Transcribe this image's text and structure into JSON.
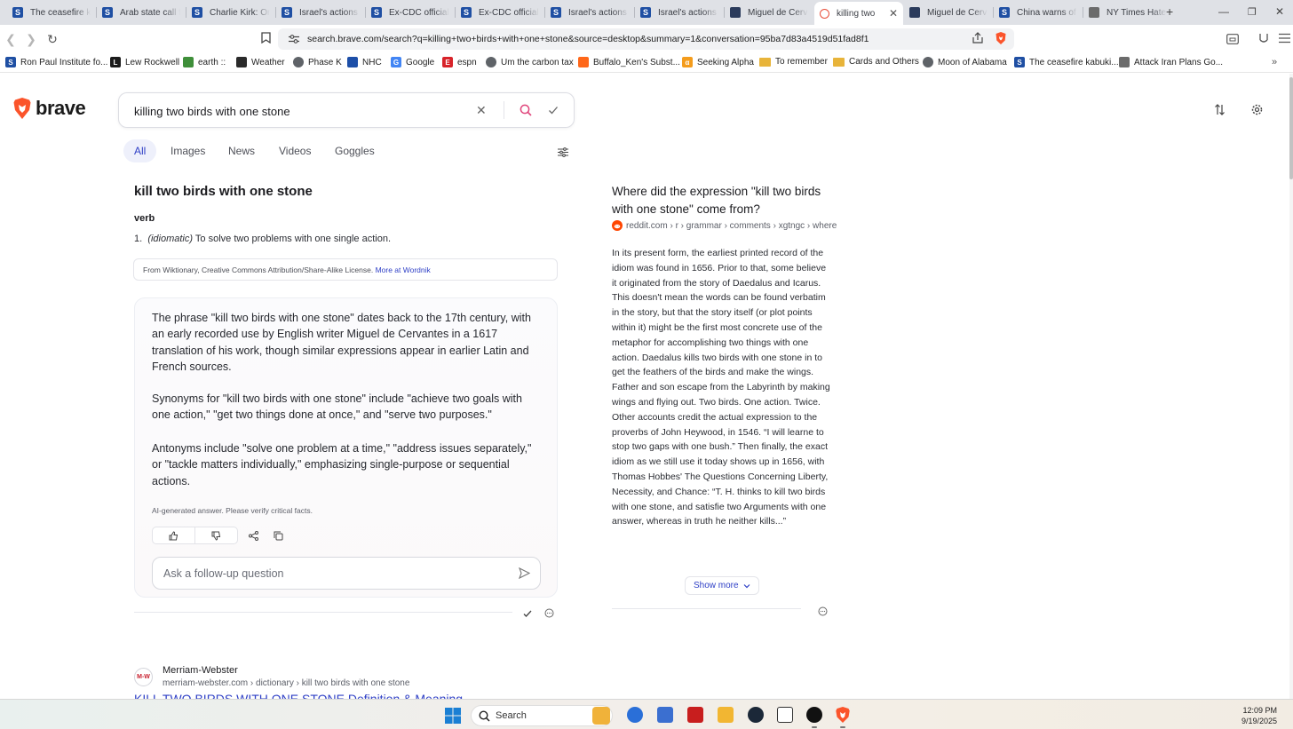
{
  "browser": {
    "tabs": [
      {
        "title": "The ceasefire k",
        "icon": "s"
      },
      {
        "title": "Arab state call f",
        "icon": "s"
      },
      {
        "title": "Charlie Kirk: Or",
        "icon": "s"
      },
      {
        "title": "Israel's actions",
        "icon": "s"
      },
      {
        "title": "Ex-CDC official",
        "icon": "s"
      },
      {
        "title": "Ex-CDC official",
        "icon": "s"
      },
      {
        "title": "Israel's actions",
        "icon": "s"
      },
      {
        "title": "Israel's actions",
        "icon": "s"
      },
      {
        "title": "Miguel de Cerv",
        "icon": "m"
      },
      {
        "title": "killing two",
        "icon": "b",
        "active": true
      },
      {
        "title": "Miguel de Cerv",
        "icon": "m"
      },
      {
        "title": "China warns of",
        "icon": "s"
      },
      {
        "title": "NY Times Hate",
        "icon": "n"
      }
    ],
    "url": "search.brave.com/search?q=killing+two+birds+with+one+stone&source=desktop&summary=1&conversation=95ba7d83a4519d51fad8f1",
    "bookmarks": [
      {
        "label": "Ron Paul Institute fo...",
        "icon": "s"
      },
      {
        "label": "Lew Rockwell",
        "icon": "lrc"
      },
      {
        "label": "earth ::",
        "icon": "earth"
      },
      {
        "label": "Weather",
        "icon": "weather"
      },
      {
        "label": "Phase K",
        "icon": "globe"
      },
      {
        "label": "NHC",
        "icon": "nhc"
      },
      {
        "label": "Google",
        "icon": "google"
      },
      {
        "label": "espn",
        "icon": "espn"
      },
      {
        "label": "Um the carbon tax",
        "icon": "globe"
      },
      {
        "label": "Buffalo_Ken's Subst...",
        "icon": "substack"
      },
      {
        "label": "Seeking Alpha",
        "icon": "alpha"
      },
      {
        "label": "To remember",
        "icon": "folder"
      },
      {
        "label": "Cards and Others",
        "icon": "folder"
      },
      {
        "label": "Moon of Alabama",
        "icon": "globe"
      },
      {
        "label": "The ceasefire kabuki...",
        "icon": "s"
      },
      {
        "label": "Attack Iran Plans Go...",
        "icon": "img"
      }
    ]
  },
  "search": {
    "logo_text": "brave",
    "query": "killing two birds with one stone",
    "tabs": [
      "All",
      "Images",
      "News",
      "Videos",
      "Goggles"
    ],
    "active_tab": "All"
  },
  "definition": {
    "title": "kill two birds with one stone",
    "part_of_speech": "verb",
    "number": "1.",
    "label": "(idiomatic)",
    "text": "To solve two problems with one single action.",
    "source_text": "From Wiktionary, Creative Commons Attribution/Share-Alike License.",
    "source_link": "More at Wordnik"
  },
  "ai_answer": {
    "paragraphs": [
      "The phrase \"kill two birds with one stone\" dates back to the 17th century, with an early recorded use by English writer Miguel de Cervantes in a 1617 translation of his work, though similar expressions appear in earlier Latin and French sources.",
      "Synonyms for \"kill two birds with one stone\" include \"achieve two goals with one action,\" \"get two things done at once,\" and \"serve two purposes.\"",
      "Antonyms include \"solve one problem at a time,\" \"address issues separately,\" or \"tackle matters individually,\" emphasizing single-purpose or sequential actions."
    ],
    "disclaimer": "AI-generated answer. Please verify critical facts.",
    "followup_placeholder": "Ask a follow-up question"
  },
  "discussion": {
    "title": "Where did the expression \"kill two birds with one stone\" come from?",
    "source": "reddit.com › r › grammar › comments › xgtngc › where",
    "body": "In its present form, the earliest printed record of the idiom was found in 1656. Prior to that, some believe it originated from the story of Daedalus and Icarus. This doesn't mean the words can be found verbatim in the story, but that the story itself (or plot points within it) might be the first most concrete use of the metaphor for accomplishing two things with one action. Daedalus kills two birds with one stone in to get the feathers of the birds and make the wings. Father and son escape from the Labyrinth by making wings and flying out. Two birds. One action. Twice. Other accounts credit the actual expression to the proverbs of John Heywood, in 1546. “I will learne to stop two gaps with one bush.” Then finally, the exact idiom as we still use it today shows up in 1656, with Thomas Hobbes' The Questions Concerning Liberty, Necessity, and Chance: “T. H. thinks to kill two birds with one stone, and satisfie two Arguments with one answer, whereas in truth he neither kills...”",
    "show_more": "Show more"
  },
  "result": {
    "site_name": "Merriam-Webster",
    "logo_text": "M-W",
    "breadcrumb": "merriam-webster.com › dictionary › kill two birds with one stone",
    "title": "KILL TWO BIRDS WITH ONE STONE Definition & Meaning"
  },
  "taskbar": {
    "search_label": "Search",
    "time": "12:09 PM",
    "date": "9/19/2025"
  },
  "colors": {
    "accent": "#2e3fc6",
    "brave_orange": "#fb542b",
    "search_icon": "#e0457b"
  }
}
